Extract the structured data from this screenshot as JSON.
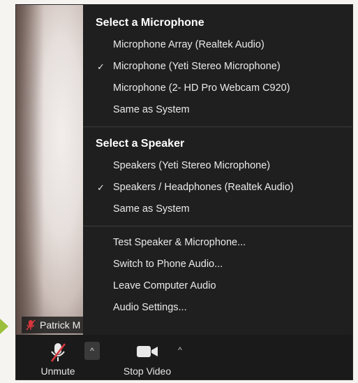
{
  "name_tag": "Patrick M",
  "microphone": {
    "title": "Select a Microphone",
    "items": [
      {
        "label": "Microphone Array (Realtek Audio)",
        "checked": false
      },
      {
        "label": "Microphone (Yeti Stereo Microphone)",
        "checked": true
      },
      {
        "label": "Microphone (2- HD Pro Webcam C920)",
        "checked": false
      },
      {
        "label": "Same as System",
        "checked": false
      }
    ]
  },
  "speaker": {
    "title": "Select a Speaker",
    "items": [
      {
        "label": "Speakers (Yeti Stereo Microphone)",
        "checked": false
      },
      {
        "label": "Speakers / Headphones (Realtek Audio)",
        "checked": true
      },
      {
        "label": "Same as System",
        "checked": false
      }
    ]
  },
  "actions": [
    {
      "label": "Test Speaker & Microphone..."
    },
    {
      "label": "Switch to Phone Audio..."
    },
    {
      "label": "Leave Computer Audio"
    },
    {
      "label": "Audio Settings..."
    }
  ],
  "toolbar": {
    "unmute_label": "Unmute",
    "stop_video_label": "Stop Video",
    "caret": "^"
  },
  "check_glyph": "✓",
  "colors": {
    "menu_bg": "#1f1f1f",
    "toolbar_bg": "#1a1a1a",
    "mute_red": "#d9363e",
    "pointer_arrow": "#9bbf3a"
  }
}
